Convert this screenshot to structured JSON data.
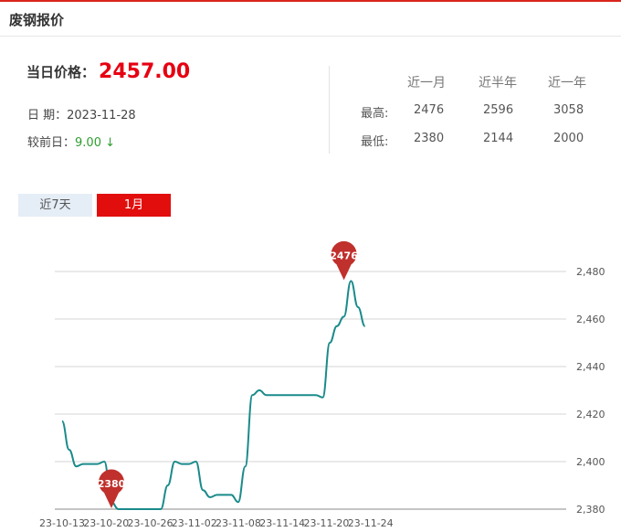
{
  "header": {
    "title": "废钢报价"
  },
  "price": {
    "label": "当日价格：",
    "value": "2457.00"
  },
  "date": {
    "label": "日 期：",
    "value": "2023-11-28"
  },
  "change": {
    "label": "较前日：",
    "value": "9.00",
    "arrow": "↓",
    "color": "#2e9e2e"
  },
  "stats": {
    "headers": [
      "近一月",
      "近半年",
      "近一年"
    ],
    "rows": [
      {
        "label": "最高:",
        "values": [
          "2476",
          "2596",
          "3058"
        ]
      },
      {
        "label": "最低:",
        "values": [
          "2380",
          "2144",
          "2000"
        ]
      }
    ]
  },
  "tabs": [
    {
      "label": "近7天",
      "active": false
    },
    {
      "label": "1月",
      "active": true
    }
  ],
  "colors": {
    "accent": "#e20e0e",
    "line": "#1a8a8a",
    "marker": "#c0302c"
  },
  "chart_data": {
    "type": "line",
    "x": [
      "2023-10-13",
      "2023-10-14",
      "2023-10-15",
      "2023-10-16",
      "2023-10-17",
      "2023-10-18",
      "2023-10-19",
      "2023-10-20",
      "2023-10-21",
      "2023-10-22",
      "2023-10-23",
      "2023-10-24",
      "2023-10-25",
      "2023-10-26",
      "2023-10-27",
      "2023-10-28",
      "2023-10-29",
      "2023-10-30",
      "2023-10-31",
      "2023-11-01",
      "2023-11-02",
      "2023-11-03",
      "2023-11-04",
      "2023-11-05",
      "2023-11-06",
      "2023-11-07",
      "2023-11-08",
      "2023-11-09",
      "2023-11-10",
      "2023-11-11",
      "2023-11-12",
      "2023-11-13",
      "2023-11-14",
      "2023-11-15",
      "2023-11-16",
      "2023-11-17",
      "2023-11-18",
      "2023-11-19",
      "2023-11-20",
      "2023-11-21",
      "2023-11-22",
      "2023-11-23",
      "2023-11-24",
      "2023-11-25"
    ],
    "series": [
      {
        "values": [
          2417,
          2405,
          2398,
          2399,
          2399,
          2399,
          2400,
          2383,
          2380,
          2380,
          2380,
          2380,
          2380,
          2380,
          2380,
          2390,
          2400,
          2399,
          2399,
          2400,
          2388,
          2385,
          2386,
          2386,
          2386,
          2383,
          2398,
          2428,
          2430,
          2428,
          2428,
          2428,
          2428,
          2428,
          2428,
          2428,
          2428,
          2427,
          2450,
          2457,
          2461,
          2476,
          2465,
          2457
        ]
      }
    ],
    "x_ticks": [
      "23-10-13",
      "23-10-20",
      "23-10-26",
      "23-11-02",
      "23-11-08",
      "23-11-14",
      "23-11-20",
      "23-11-24"
    ],
    "y_ticks": [
      "2,380",
      "2,400",
      "2,420",
      "2,440",
      "2,460",
      "2,480"
    ],
    "ylim": [
      2380,
      2480
    ],
    "markers": [
      {
        "label": "2476",
        "x": "2023-11-22",
        "y": 2476
      },
      {
        "label": "2380",
        "x": "2023-10-20",
        "y": 2380
      }
    ],
    "grid": true
  }
}
